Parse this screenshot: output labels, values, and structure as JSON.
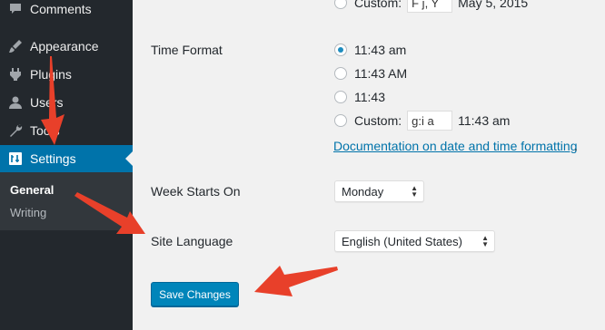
{
  "sidebar": {
    "items": [
      {
        "label": "Comments",
        "icon": "comments-icon"
      },
      {
        "label": "Appearance",
        "icon": "appearance-icon"
      },
      {
        "label": "Plugins",
        "icon": "plugins-icon"
      },
      {
        "label": "Users",
        "icon": "users-icon"
      },
      {
        "label": "Tools",
        "icon": "tools-icon"
      },
      {
        "label": "Settings",
        "icon": "settings-icon",
        "active": true
      }
    ],
    "submenu": [
      {
        "label": "General",
        "current": true
      },
      {
        "label": "Writing"
      }
    ]
  },
  "date_format": {
    "custom_label": "Custom:",
    "custom_value": "F j, Y",
    "custom_preview": "May 5, 2015"
  },
  "time_format": {
    "label": "Time Format",
    "options": [
      {
        "label": "11:43 am",
        "checked": true
      },
      {
        "label": "11:43 AM",
        "checked": false
      },
      {
        "label": "11:43",
        "checked": false
      }
    ],
    "custom_label": "Custom:",
    "custom_value": "g:i a",
    "custom_preview": "11:43 am",
    "doc_link": "Documentation on date and time formatting",
    "doc_period": "."
  },
  "week_starts_on": {
    "label": "Week Starts On",
    "selected": "Monday"
  },
  "site_language": {
    "label": "Site Language",
    "selected": "English (United States)"
  },
  "save_button": "Save Changes",
  "colors": {
    "sidebar_bg": "#23282d",
    "active_bg": "#0073aa",
    "button_bg": "#0085ba",
    "link": "#0073aa",
    "annotation_arrow": "#e8402a"
  }
}
